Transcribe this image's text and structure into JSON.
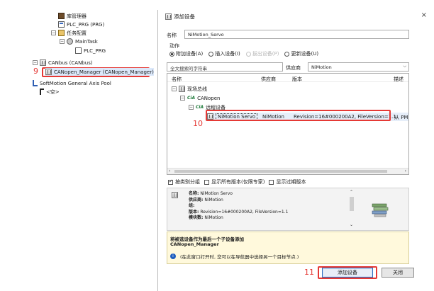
{
  "tree": {
    "library_manager": "库管理器",
    "plc_prg_prg": "PLC_PRG (PRG)",
    "task_config": "任务配置",
    "main_task": "MainTask",
    "plc_prg": "PLC_PRG",
    "canbus": "CANbus (CANbus)",
    "canopen_manager": "CANopen_Manager (CANopen_Manager)",
    "softmotion_pool": "SoftMotion General Axis Pool",
    "empty_slot": "<空>"
  },
  "annotations": {
    "step9": "9",
    "step10": "10",
    "step11": "11"
  },
  "dialog": {
    "title": "添加设备",
    "close_glyph": "×",
    "name_label": "名称",
    "name_value": "NiMotion_Servo",
    "action_label": "动作",
    "radio_attach": "附加设备(A)",
    "radio_insert": "插入设备(I)",
    "radio_plug": "拔出设备(P)",
    "radio_update": "更新设备(U)",
    "search_placeholder": "全文搜索的字符串",
    "vendor_label": "供应商",
    "vendor_value": "NiMotion",
    "columns": {
      "name": "名称",
      "vendor": "供应商",
      "version": "版本",
      "desc": "描述"
    },
    "tree_fieldbus": "现场总线",
    "tree_canopen": "CANopen",
    "tree_remote": "远程设备",
    "device_row": {
      "name": "NiMotion Servo",
      "vendor": "NiMotion",
      "version": "Revision=16#000200A2, FileVersion=1.1",
      "desc": "从 PMM"
    },
    "chk_group": "按类别分组",
    "chk_all_versions": "显示所有版本(仅限专家)",
    "chk_outdated": "显示过期版本",
    "info": {
      "name_key": "名称:",
      "name_val": "NiMotion Servo",
      "vendor_key": "供应商:",
      "vendor_val": "NiMotion",
      "group_key": "组:",
      "version_key": "版本:",
      "version_val": "Revision=16#000200A2, FileVersion=1.1",
      "model_key": "模块数:",
      "model_val": "NiMotion"
    },
    "append_title": "将被选设备作为最后一个子设备添加",
    "append_parent": "CANopen_Manager",
    "append_hint": "(在此窗口打开时, 您可以在导航器中选择另一个目标节点.)",
    "add_button": "添加设备",
    "close_button": "关闭"
  }
}
